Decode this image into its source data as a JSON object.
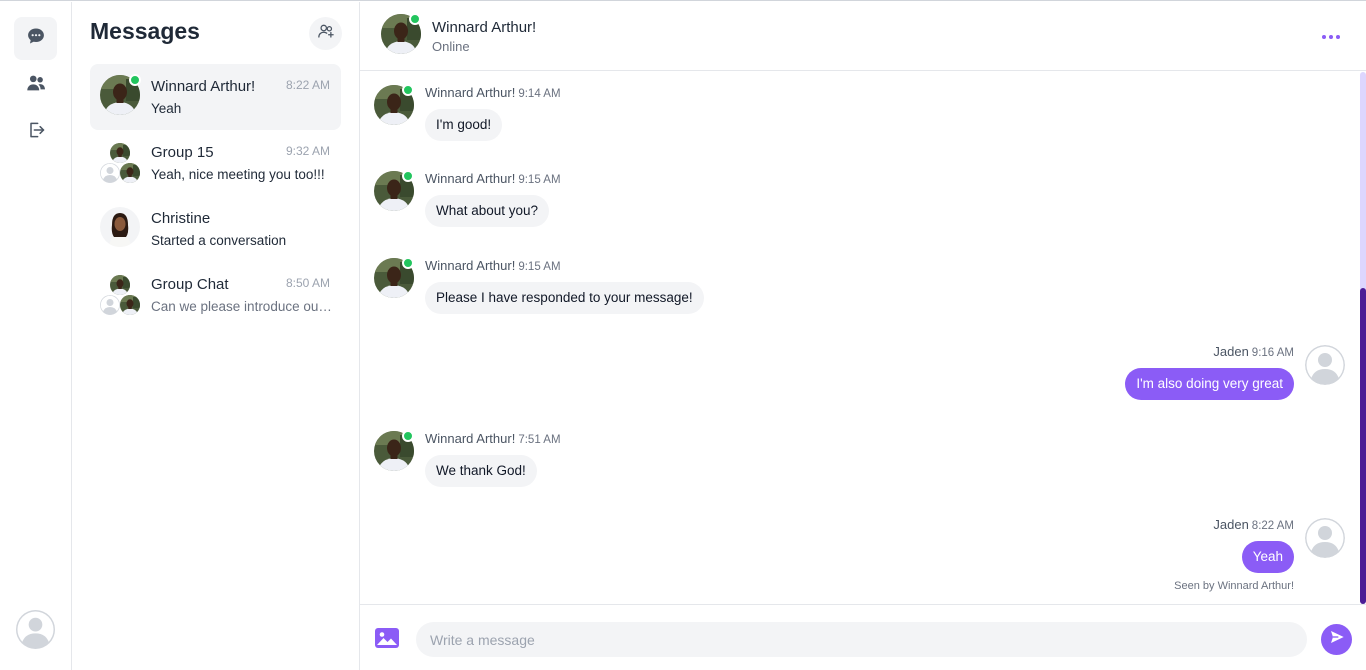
{
  "rail": {
    "items": [
      {
        "icon": "chat-bubble-icon",
        "active": true
      },
      {
        "icon": "users-icon",
        "active": false
      },
      {
        "icon": "logout-icon",
        "active": false
      }
    ],
    "user_avatar": "default-avatar"
  },
  "list": {
    "title": "Messages",
    "conversations": [
      {
        "name": "Winnard Arthur!",
        "time": "8:22 AM",
        "preview": "Yeah"
      },
      {
        "name": "Group 15",
        "time": "9:32 AM",
        "preview": "Yeah, nice meeting you too!!!"
      },
      {
        "name": "Christine",
        "time": "",
        "preview": "Started a conversation"
      },
      {
        "name": "Group Chat",
        "time": "8:50 AM",
        "preview": "Can we please introduce ourselves"
      }
    ]
  },
  "chat": {
    "header": {
      "name": "Winnard Arthur!",
      "status": "Online"
    },
    "messages": [
      {
        "sender": "Winnard Arthur!",
        "time": "9:14 AM",
        "text": "I'm good!"
      },
      {
        "sender": "Winnard Arthur!",
        "time": "9:15 AM",
        "text": "What about you?"
      },
      {
        "sender": "Winnard Arthur!",
        "time": "9:15 AM",
        "text": "Please I have responded to your message!"
      },
      {
        "sender": "Jaden",
        "time": "9:16 AM",
        "text": "I'm also doing very great"
      },
      {
        "sender": "Winnard Arthur!",
        "time": "7:51 AM",
        "text": "We thank God!"
      },
      {
        "sender": "Jaden",
        "time": "8:22 AM",
        "text": "Yeah"
      }
    ],
    "seen": "Seen by Winnard Arthur!",
    "composer": {
      "placeholder": "Write a message"
    }
  },
  "colors": {
    "accent": "#8b5cf6",
    "online": "#22c55e",
    "scroll_track": "#ddd6fe",
    "scroll_thumb": "#4c1d95"
  }
}
